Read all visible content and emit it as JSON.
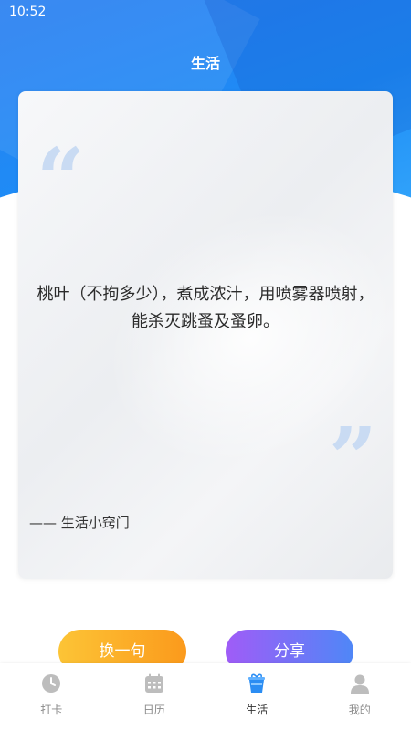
{
  "status_bar": {
    "time": "10:52"
  },
  "header": {
    "title": "生活"
  },
  "quote": {
    "text": "桃叶（不拘多少），煮成浓汁，用喷雾器喷射，能杀灭跳蚤及蚤卵。",
    "source": "—— 生活小窍门",
    "open_mark": "“",
    "close_mark": "”"
  },
  "buttons": {
    "next": "换一句",
    "share": "分享"
  },
  "tabbar": {
    "items": [
      {
        "label": "打卡",
        "icon": "clock-icon"
      },
      {
        "label": "日历",
        "icon": "calendar-icon"
      },
      {
        "label": "生活",
        "icon": "gift-cup-icon"
      },
      {
        "label": "我的",
        "icon": "user-icon"
      }
    ],
    "active": "生活"
  },
  "colors": {
    "header_blue": "#1e8cf6",
    "next_button": "#fb9a1c",
    "share_button": "#8a6cf7",
    "active_tab_icon": "#2b8df3"
  }
}
